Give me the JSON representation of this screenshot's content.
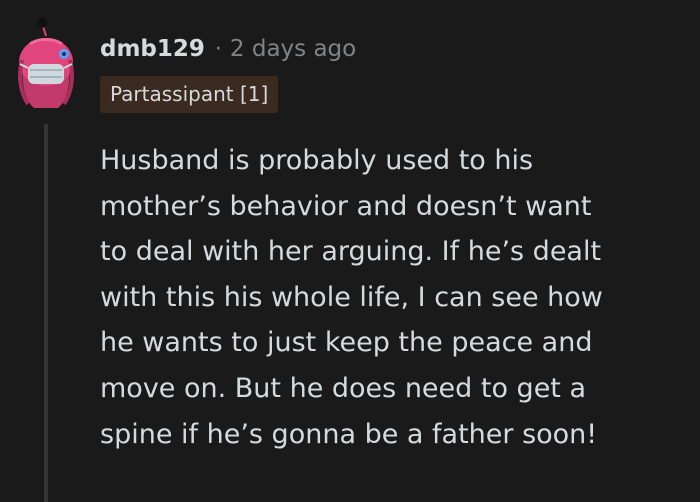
{
  "comment": {
    "username": "dmb129",
    "separator": "·",
    "timestamp": "2 days ago",
    "flair": "Partassipant [1]",
    "body_lines": [
      "Husband is probably used to his",
      "mother’s behavior and doesn’t want",
      "to deal with her arguing. If he’s dealt",
      "with this his whole life, I can see how",
      "he wants to just keep the peace and",
      "move on. But he does need to get a",
      "spine if he’s gonna be a father soon!"
    ]
  },
  "avatar": {
    "icon": "snoo-avatar-icon",
    "hair_color": "#e0457b",
    "mask_color": "#cfd8dc"
  },
  "colors": {
    "background": "#1a1a1b",
    "text": "#d7dadc",
    "muted": "#818384",
    "flair_bg": "#3a2a20",
    "thread_line": "#343536"
  }
}
